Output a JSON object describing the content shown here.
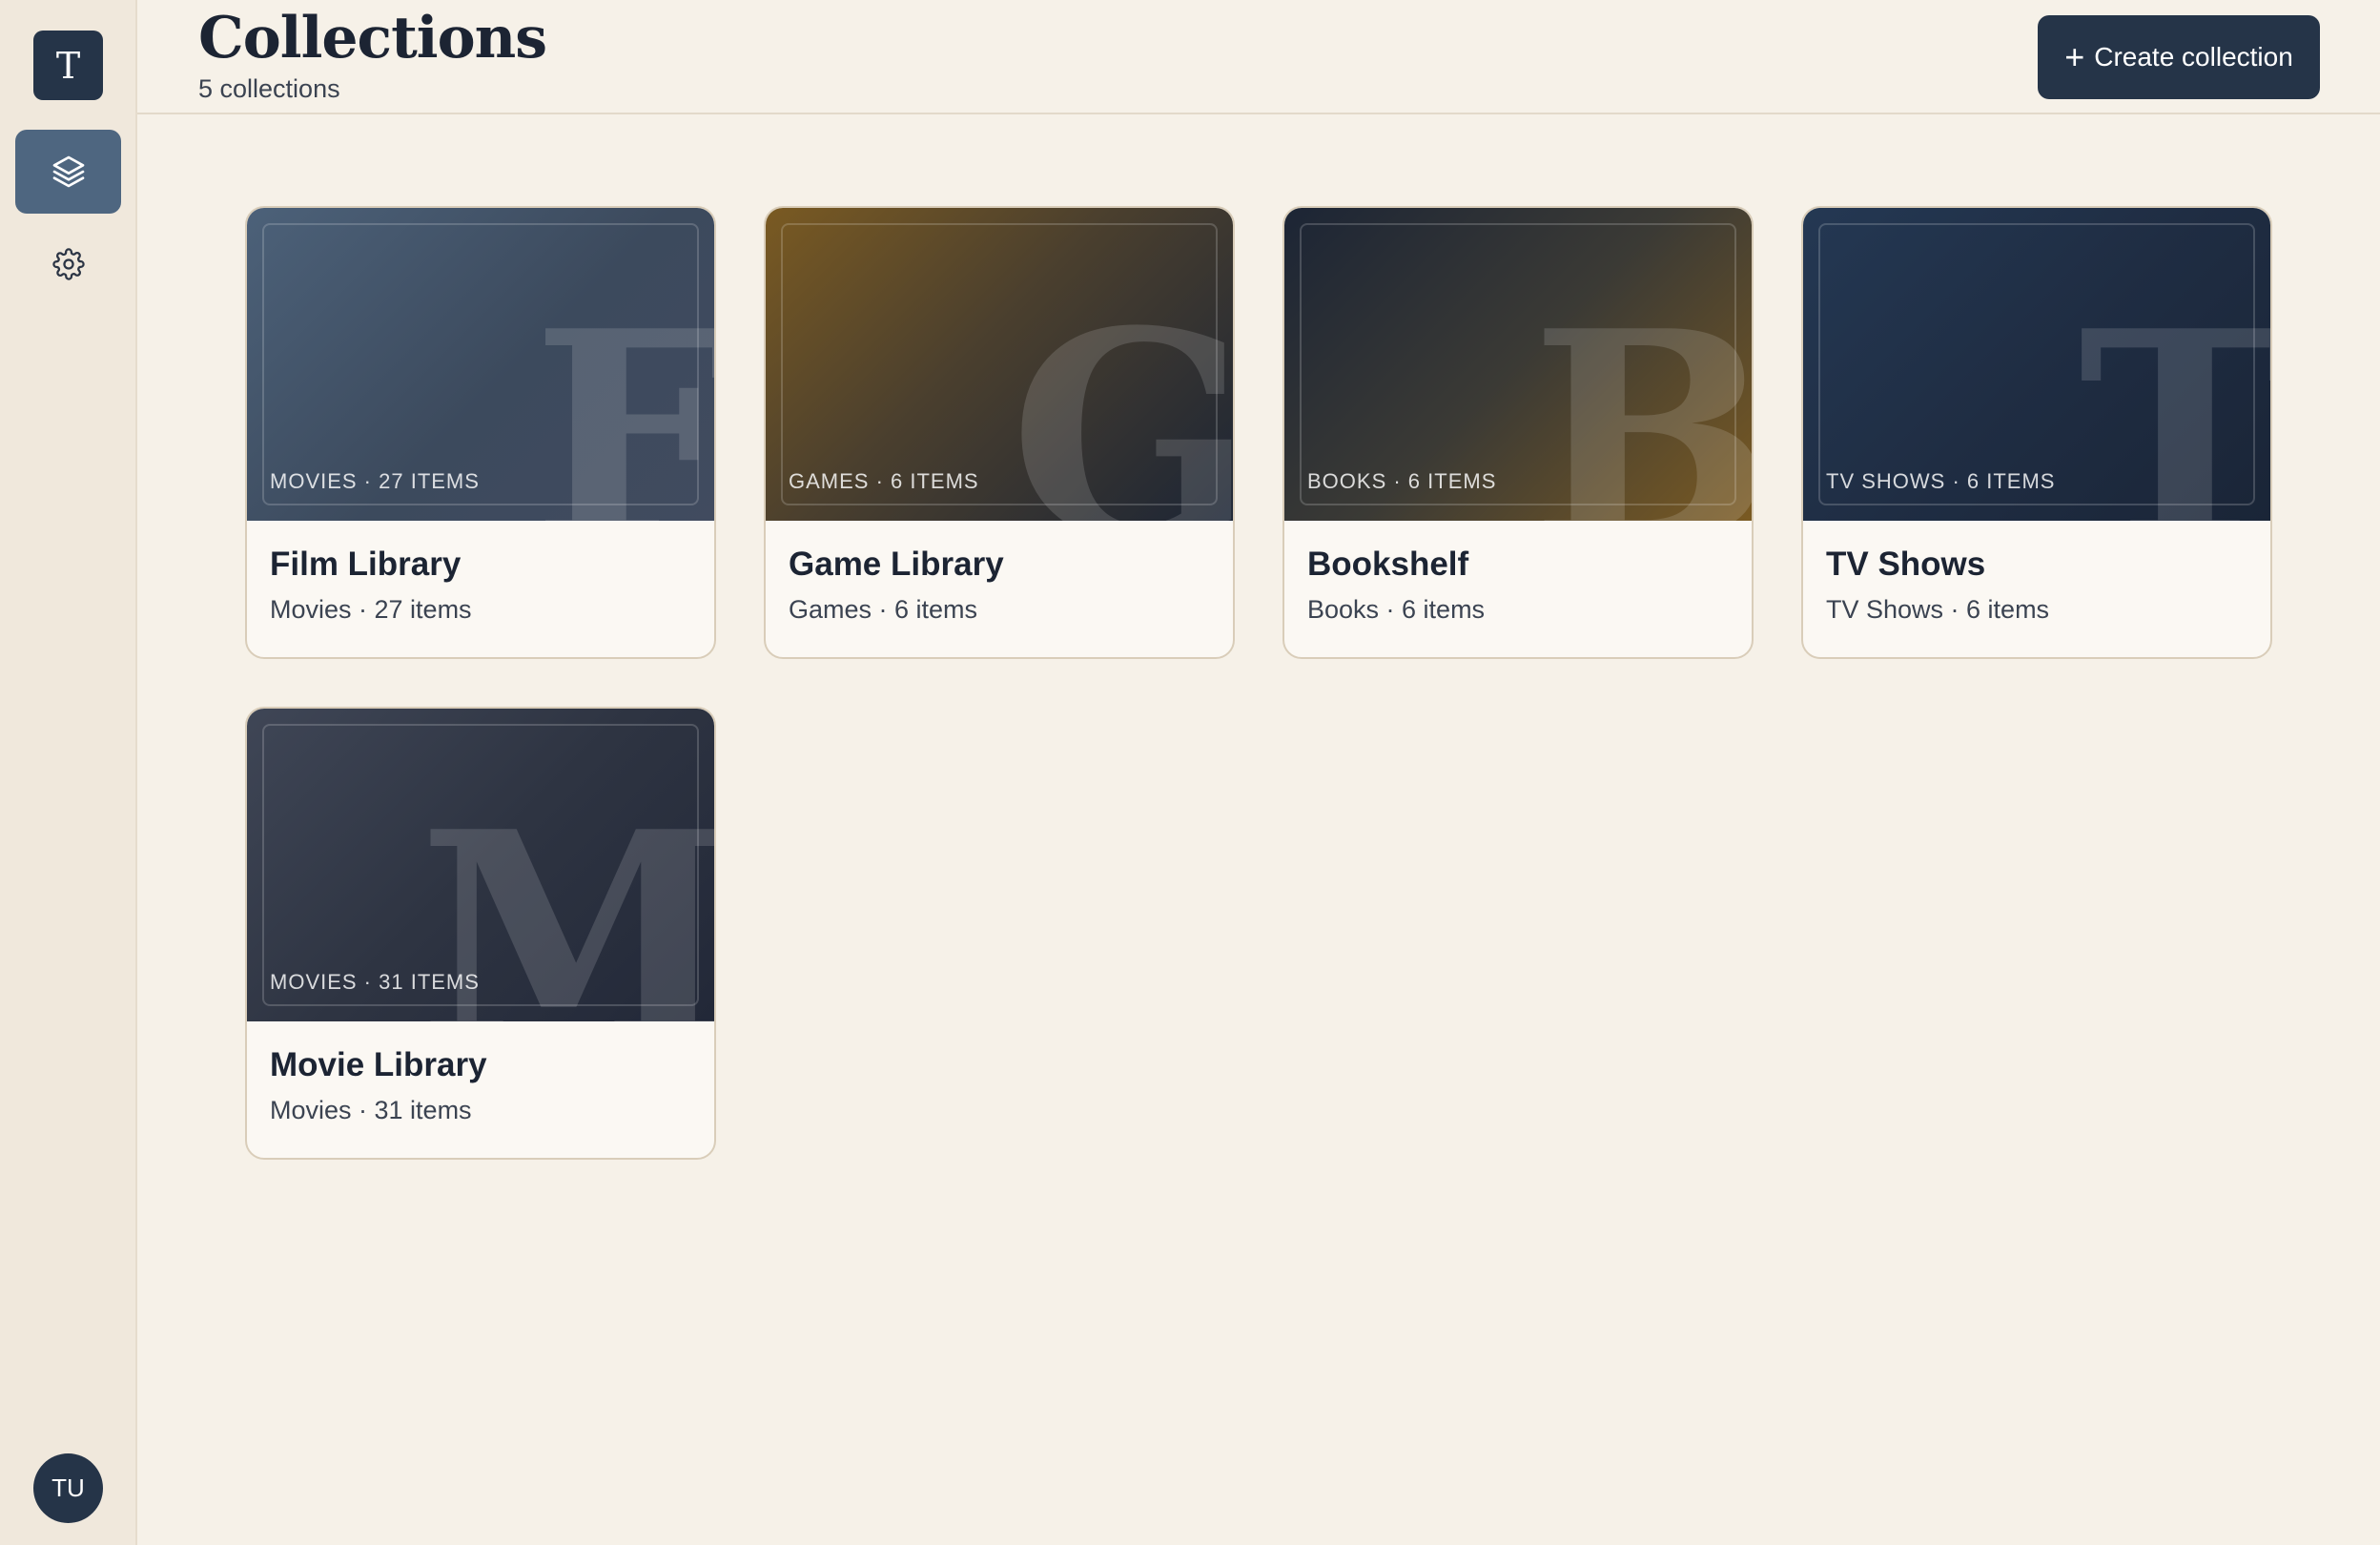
{
  "sidebar": {
    "logo_letter": "T",
    "nav": [
      {
        "name": "collections",
        "icon": "layers-icon",
        "active": true
      },
      {
        "name": "settings",
        "icon": "gear-icon",
        "active": false
      }
    ],
    "avatar_initials": "TU"
  },
  "header": {
    "title": "Collections",
    "subtitle": "5 collections",
    "create_label": "Create collection"
  },
  "collections": [
    {
      "title": "Film Library",
      "cover_label": "MOVIES · 27 ITEMS",
      "meta": "Movies · 27 items",
      "letter": "F",
      "theme": "film"
    },
    {
      "title": "Game Library",
      "cover_label": "GAMES · 6 ITEMS",
      "meta": "Games · 6 items",
      "letter": "G",
      "theme": "game"
    },
    {
      "title": "Bookshelf",
      "cover_label": "BOOKS · 6 ITEMS",
      "meta": "Books · 6 items",
      "letter": "B",
      "theme": "book"
    },
    {
      "title": "TV Shows",
      "cover_label": "TV SHOWS · 6 ITEMS",
      "meta": "TV Shows · 6 items",
      "letter": "T",
      "theme": "tv"
    },
    {
      "title": "Movie Library",
      "cover_label": "MOVIES · 31 ITEMS",
      "meta": "Movies · 31 items",
      "letter": "M",
      "theme": "movie"
    }
  ],
  "colors": {
    "background": "#f6f1e8",
    "sidebar": "#f0e8dc",
    "primary": "#253448",
    "active_nav": "#4e6680",
    "text": "#1c2433"
  }
}
